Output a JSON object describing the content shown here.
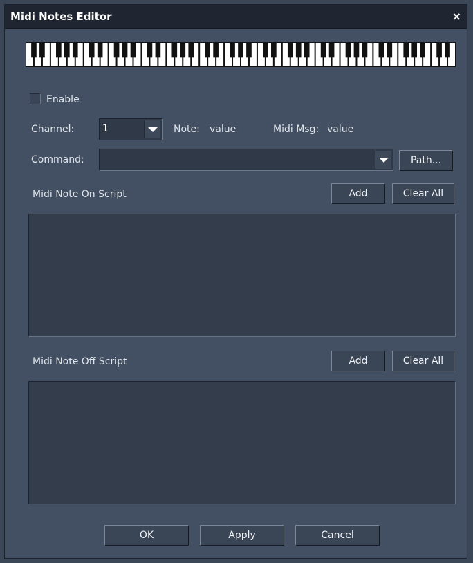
{
  "window": {
    "title": "Midi Notes Editor",
    "close_glyph": "×"
  },
  "enable": {
    "label": "Enable",
    "checked": false
  },
  "channel": {
    "label": "Channel:",
    "value": "1"
  },
  "note": {
    "label": "Note:",
    "value": "value"
  },
  "midi_msg": {
    "label": "Midi Msg:",
    "value": "value"
  },
  "command": {
    "label": "Command:",
    "value": "",
    "path_button": "Path..."
  },
  "note_on": {
    "label": "Midi Note On Script",
    "add": "Add",
    "clear": "Clear All",
    "content": ""
  },
  "note_off": {
    "label": "Midi Note Off Script",
    "add": "Add",
    "clear": "Clear All",
    "content": ""
  },
  "footer": {
    "ok": "OK",
    "apply": "Apply",
    "cancel": "Cancel"
  },
  "colors": {
    "window_bg": "#435063",
    "titlebar": "#1f2631",
    "field_bg": "#2f3947",
    "text": "#dfe4ea"
  }
}
